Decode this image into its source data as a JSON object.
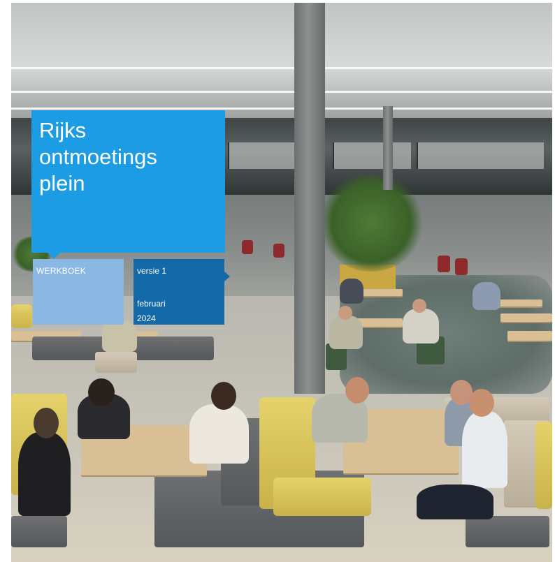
{
  "cover": {
    "title_lines": [
      "Rijks",
      "ontmoetings",
      "plein"
    ],
    "label_left": "WERKBOEK",
    "version": "versie 1",
    "date_month": "februari",
    "date_year": "2024"
  },
  "colors": {
    "title_box": "#1d9ce6",
    "workbook_box": "#8bb7e3",
    "version_box": "#1469a8"
  }
}
